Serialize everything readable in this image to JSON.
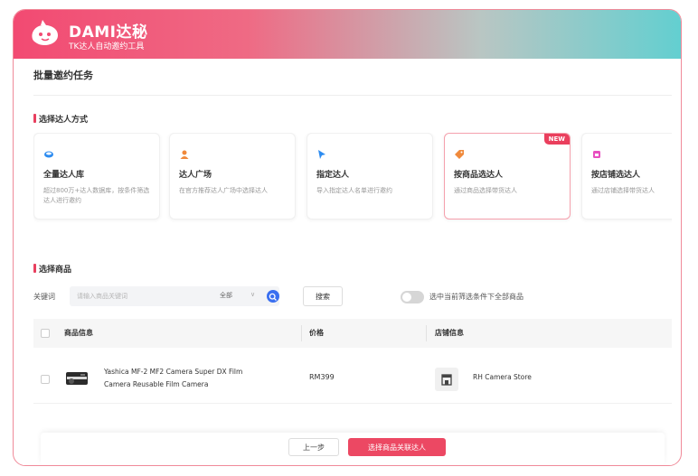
{
  "header": {
    "brand": "DAMI达秘",
    "slogan": "TK达人自动邀约工具"
  },
  "page": {
    "title": "批量邀约任务"
  },
  "selection_method": {
    "section_title": "选择达人方式",
    "cards": [
      {
        "title": "全量达人库",
        "desc": "超过800万+达人数据库，按条件筛选达人进行邀约",
        "icon": "database-icon",
        "color": "#2d8cf0",
        "active": false
      },
      {
        "title": "达人广场",
        "desc": "在官方推荐达人广场中选择达人",
        "icon": "user-icon",
        "color": "#f08a3c",
        "active": false
      },
      {
        "title": "指定达人",
        "desc": "导入指定达人名单进行邀约",
        "icon": "cursor-icon",
        "color": "#2d8cf0",
        "active": false
      },
      {
        "title": "按商品选达人",
        "desc": "通过商品选择带货达人",
        "icon": "tag-icon",
        "color": "#f08a3c",
        "active": true,
        "badge": "NEW"
      },
      {
        "title": "按店铺选达人",
        "desc": "通过店铺选择带货达人",
        "icon": "shop-icon",
        "color": "#e84fc0",
        "active": false
      }
    ]
  },
  "product_section": {
    "section_title": "选择商品",
    "keyword_label": "关键词",
    "keyword_placeholder": "请输入商品关键词",
    "select_value": "全部",
    "search_button": "搜索",
    "toggle_label": "选中当前筛选条件下全部商品"
  },
  "table": {
    "headers": [
      "商品信息",
      "价格",
      "店铺信息"
    ],
    "rows": [
      {
        "product": "Yashica MF-2 MF2 Camera Super DX Film Camera Reusable Film Camera",
        "price": "RM399",
        "store": "RH Camera Store"
      }
    ]
  },
  "footer": {
    "prev_button": "上一步",
    "next_button": "选择商品关联达人"
  },
  "colors": {
    "accent": "#ec4863",
    "header_gradient_start": "#f24a72",
    "header_gradient_end": "#63cfd0"
  }
}
